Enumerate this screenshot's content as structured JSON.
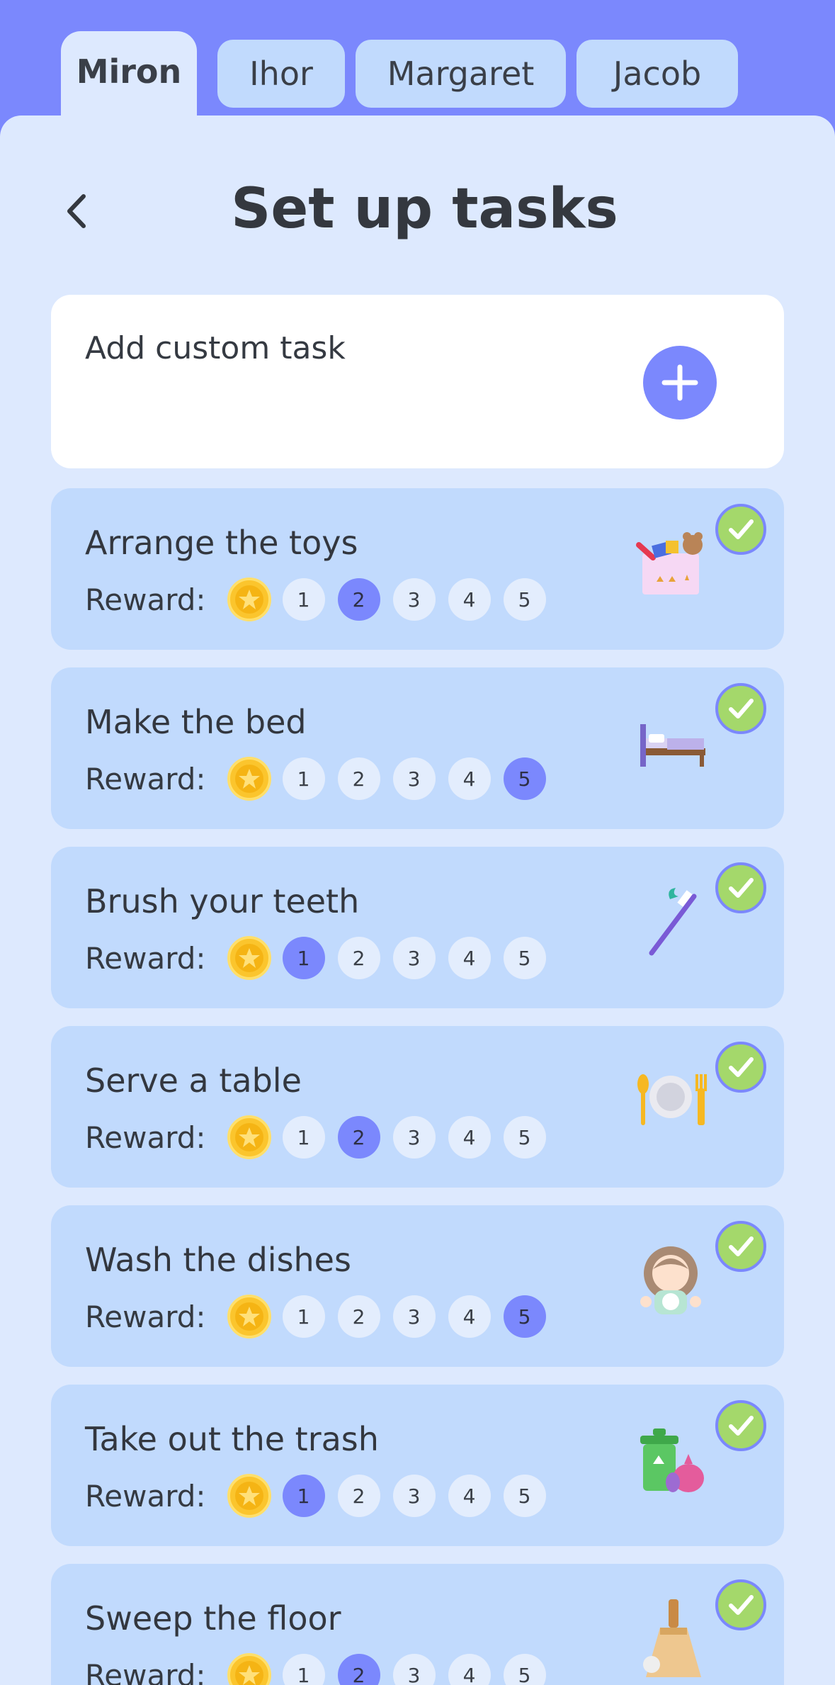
{
  "tabs": [
    {
      "label": "Miron",
      "active": true
    },
    {
      "label": "Ihor",
      "active": false
    },
    {
      "label": "Margaret",
      "active": false
    },
    {
      "label": "Jacob",
      "active": false
    }
  ],
  "header": {
    "title": "Set up tasks",
    "back_icon": "chevron-left-icon"
  },
  "custom_task": {
    "label": "Add custom task",
    "icon": "plus-icon"
  },
  "reward_label": "Reward:",
  "reward_options": [
    "1",
    "2",
    "3",
    "4",
    "5"
  ],
  "colors": {
    "accent": "#7b88fd",
    "check": "#a4d86b",
    "coin": "#fbc52d"
  },
  "tasks": [
    {
      "name": "Arrange the toys",
      "reward": 2,
      "icon": "toy-box-icon"
    },
    {
      "name": "Make the bed",
      "reward": 5,
      "icon": "bed-icon"
    },
    {
      "name": "Brush your teeth",
      "reward": 1,
      "icon": "toothbrush-icon"
    },
    {
      "name": "Serve a table",
      "reward": 2,
      "icon": "plate-cutlery-icon"
    },
    {
      "name": "Wash the dishes",
      "reward": 5,
      "icon": "girl-washing-dishes-icon"
    },
    {
      "name": "Take out the trash",
      "reward": 1,
      "icon": "trash-bin-icon"
    },
    {
      "name": "Sweep the floor",
      "reward": 2,
      "icon": "broom-icon"
    }
  ]
}
